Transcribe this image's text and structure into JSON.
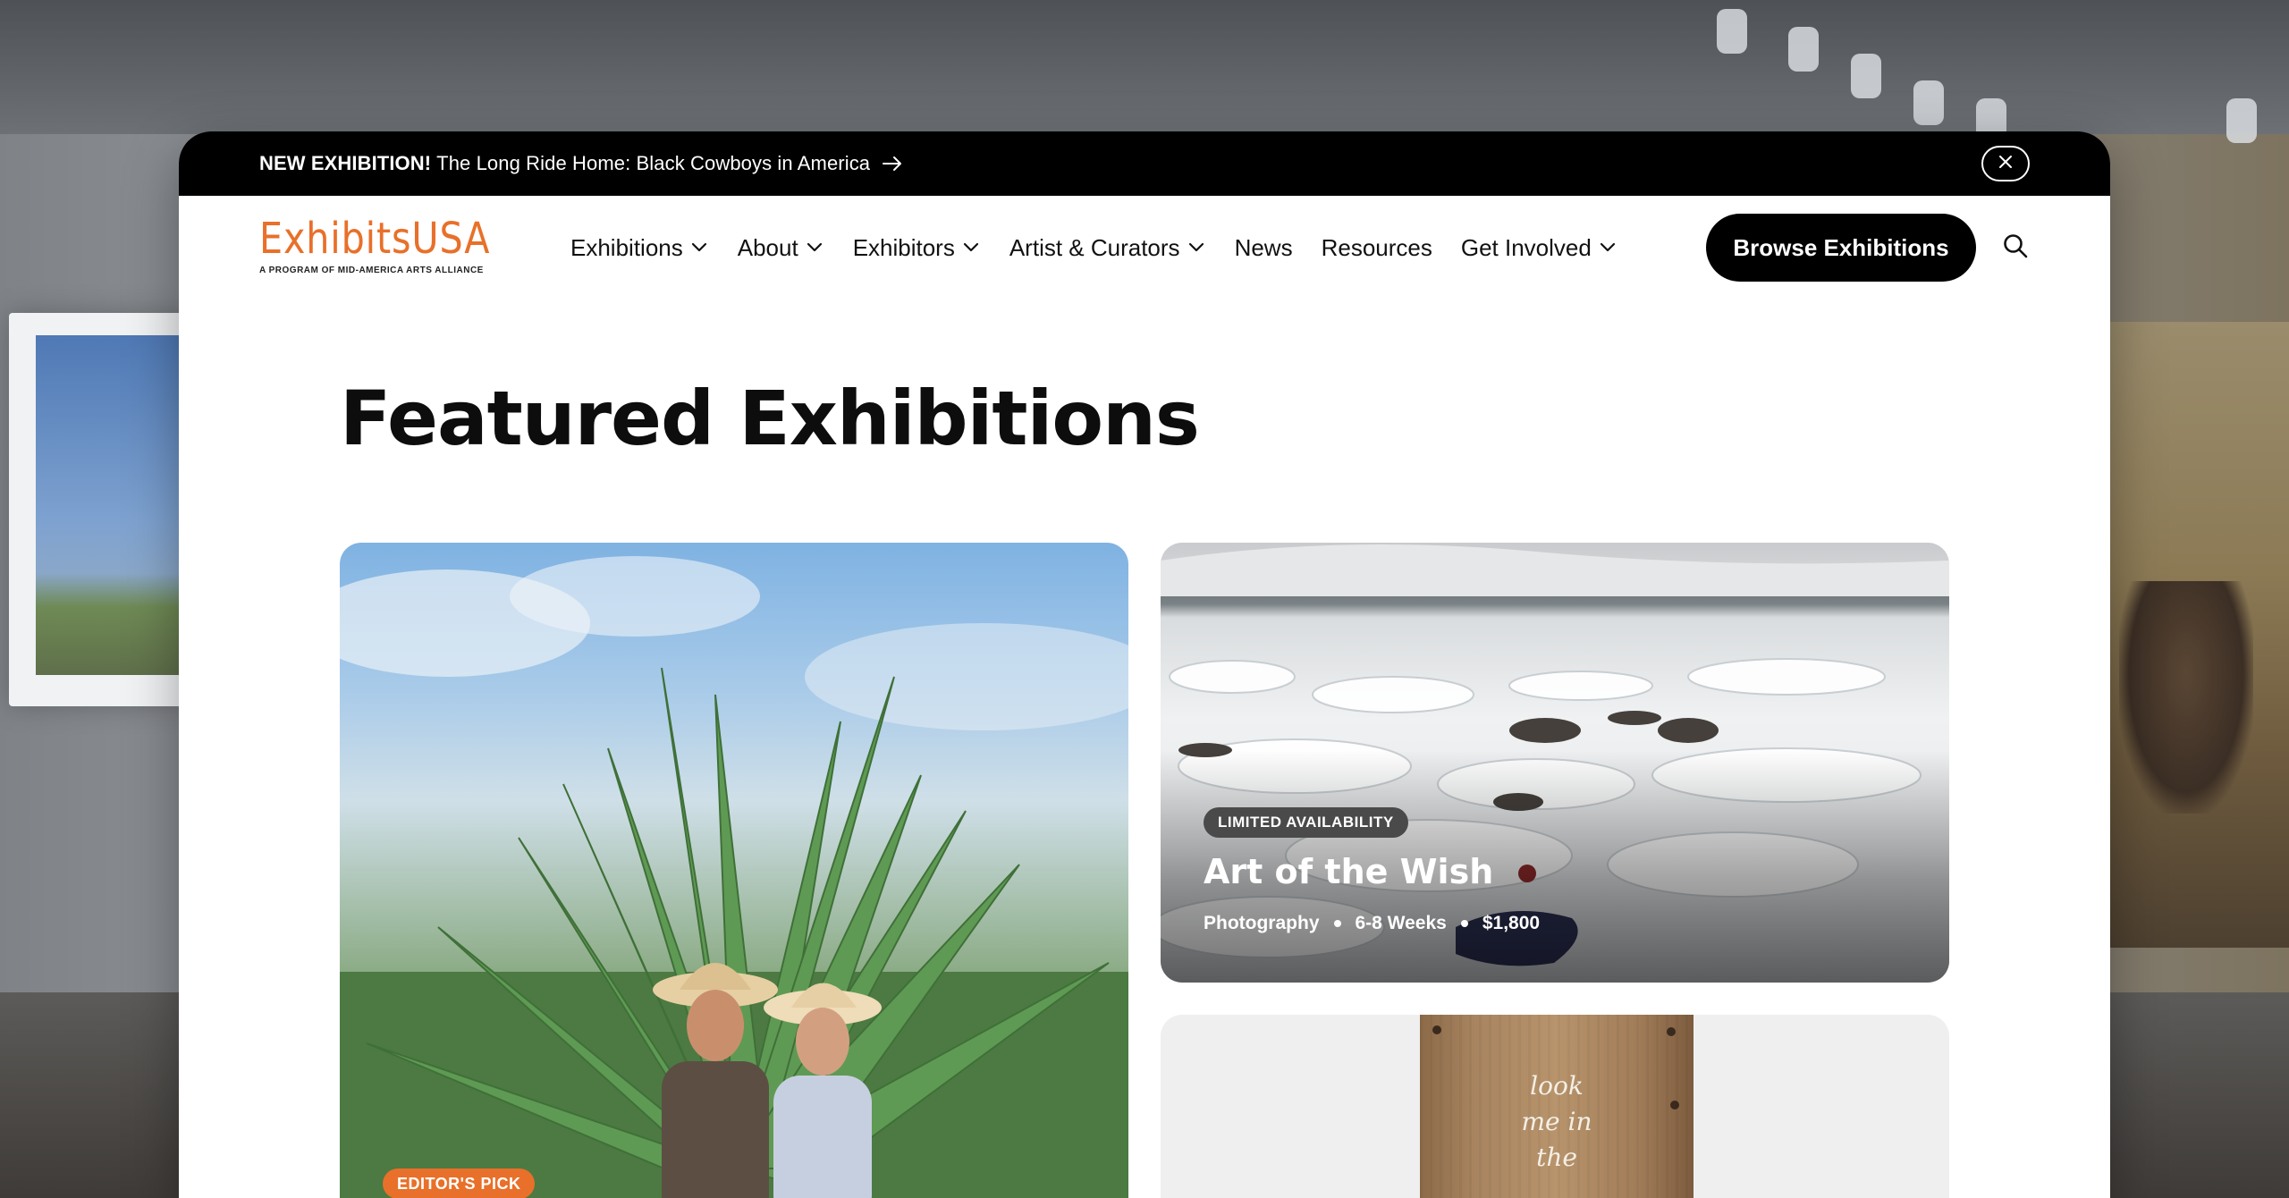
{
  "announcement": {
    "label": "NEW EXHIBITION!",
    "text": "The Long Ride Home: Black Cowboys in America"
  },
  "brand": {
    "name": "ExhibitsUSA",
    "tagline": "A PROGRAM OF MID-AMERICA ARTS ALLIANCE",
    "accent_color": "#e8702a"
  },
  "nav": {
    "items": [
      {
        "label": "Exhibitions",
        "has_dropdown": true
      },
      {
        "label": "About",
        "has_dropdown": true
      },
      {
        "label": "Exhibitors",
        "has_dropdown": true
      },
      {
        "label": "Artist & Curators",
        "has_dropdown": true
      },
      {
        "label": "News",
        "has_dropdown": false
      },
      {
        "label": "Resources",
        "has_dropdown": false
      },
      {
        "label": "Get Involved",
        "has_dropdown": true
      }
    ],
    "cta_label": "Browse Exhibitions",
    "search_icon": "search-icon"
  },
  "main": {
    "title": "Featured Exhibitions",
    "features": [
      {
        "badge": "EDITOR'S PICK",
        "image": "two elders in cowboy hats before an agave plant"
      },
      {
        "badge": "LIMITED AVAILABILITY",
        "title": "Art of the Wish",
        "meta": [
          "Photography",
          "6-8 Weeks",
          "$1,800"
        ]
      },
      {
        "wood_text": "look me in the"
      }
    ]
  },
  "icons": {
    "announcement_arrow": "arrow-right-icon",
    "close": "close-icon",
    "dropdown": "chevron-down-icon"
  }
}
